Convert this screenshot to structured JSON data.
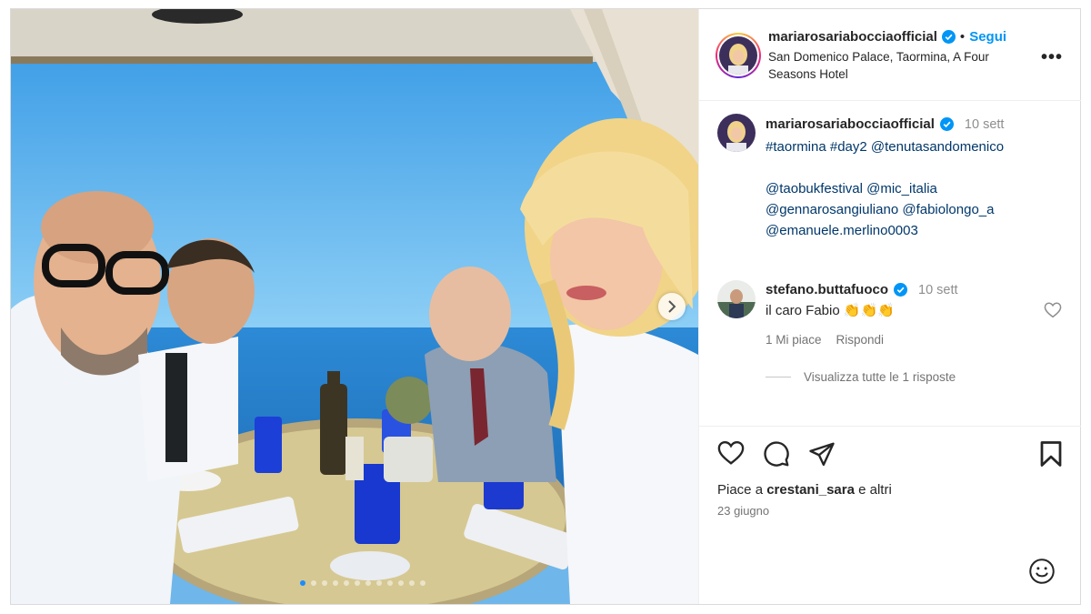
{
  "post": {
    "location": "San Domenico Palace, Taormina, A Four Seasons Hotel",
    "carousel_total": 12,
    "carousel_active": 1
  },
  "header": {
    "username": "mariarosariabocciaofficial",
    "separator": "•",
    "follow_label": "Segui",
    "more_label": "•••"
  },
  "caption": {
    "username": "mariarosariabocciaofficial",
    "time": "10 sett",
    "lines": [
      "#taormina #day2 @tenutasandomenico",
      "",
      "@taobukfestival @mic_italia",
      "@gennarosangiuliano @fabiolongo_a",
      "@emanuele.merlino0003"
    ]
  },
  "comment": {
    "username": "stefano.buttafuoco",
    "time": "10 sett",
    "text": "il caro Fabio 👏👏👏",
    "likes": "1 Mi piace",
    "reply_label": "Rispondi",
    "view_replies": "Visualizza tutte le 1 risposte"
  },
  "footer": {
    "likes_prefix": "Piace a ",
    "likes_user": "crestani_sara",
    "likes_suffix": " e altri",
    "date": "23 giugno"
  },
  "icons": {
    "like": "heart-icon",
    "comment": "comment-icon",
    "share": "paper-plane-icon",
    "save": "bookmark-icon",
    "emoji": "smiley-icon",
    "verified": "verified-badge-icon",
    "next": "chevron-right-icon"
  },
  "colors": {
    "link": "#00376b",
    "follow": "#0095f6",
    "verified": "#0095f6",
    "muted": "#737373"
  }
}
